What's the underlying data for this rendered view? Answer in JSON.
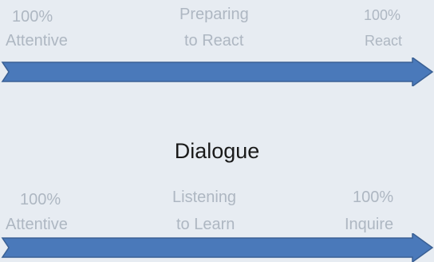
{
  "title": "Dialogue",
  "rows": [
    {
      "left": {
        "line1": "100%",
        "line2": "Attentive"
      },
      "middle": {
        "line1": "Preparing",
        "line2": "to React"
      },
      "right": {
        "line1": "100%",
        "line2": "React"
      }
    },
    {
      "left": {
        "line1": "100%",
        "line2": "Attentive"
      },
      "middle": {
        "line1": "Listening",
        "line2": "to Learn"
      },
      "right": {
        "line1": "100%",
        "line2": "Inquire"
      }
    }
  ],
  "colors": {
    "background": "#e7ecf2",
    "arrow_fill": "#4a79ba",
    "arrow_stroke": "#3a6094",
    "muted_text": "#aeb7c2",
    "title_text": "#1a1a1a"
  },
  "icons": {
    "arrow": "right-arrow-icon"
  }
}
